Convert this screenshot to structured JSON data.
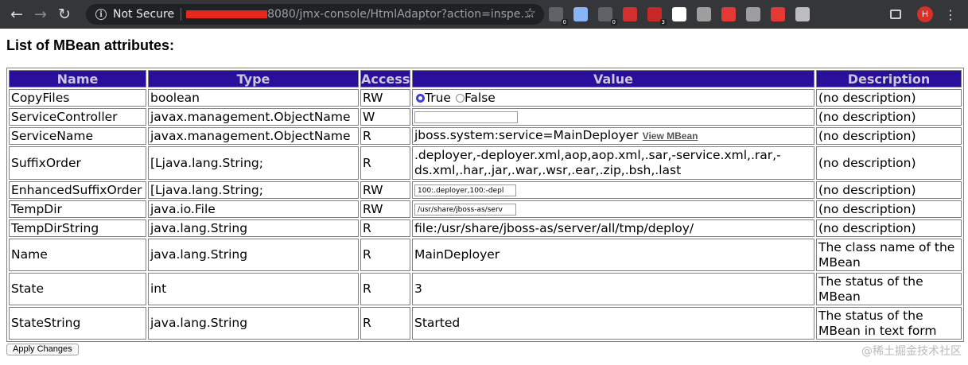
{
  "browser": {
    "security_label": "Not Secure",
    "url_visible": "8080/jmx-console/HtmlAdaptor?action=inspe...",
    "avatar_initial": "H",
    "extensions": [
      {
        "icon": "shield-extension-icon",
        "color": "#5f6368",
        "badge": "0"
      },
      {
        "icon": "drive-icon",
        "color": "#8ab4f8",
        "badge": ""
      },
      {
        "icon": "parking-icon",
        "color": "#5f6368",
        "badge": "0"
      },
      {
        "icon": "adblock-plus-icon",
        "color": "#d32f2f",
        "badge": ""
      },
      {
        "icon": "puzzle-extension-icon",
        "color": "#c62828",
        "badge": "3"
      },
      {
        "icon": "shield-check-icon",
        "color": "#ffffff",
        "badge": ""
      },
      {
        "icon": "mail-icon",
        "color": "#9e9e9e",
        "badge": ""
      },
      {
        "icon": "record-icon",
        "color": "#e53935",
        "badge": ""
      },
      {
        "icon": "grammarly-icon",
        "color": "#9e9e9e",
        "badge": ""
      },
      {
        "icon": "block-icon",
        "color": "#e53935",
        "badge": ""
      },
      {
        "icon": "grid-extension-icon",
        "color": "#bdbdbd",
        "badge": ""
      }
    ]
  },
  "page": {
    "heading": "List of MBean attributes:",
    "apply_button": "Apply Changes",
    "watermark": "@稀土掘金技术社区"
  },
  "table": {
    "headers": [
      "Name",
      "Type",
      "Access",
      "Value",
      "Description"
    ],
    "rows": [
      {
        "name": "CopyFiles",
        "type": "boolean",
        "access": "RW",
        "value_kind": "radio",
        "radio_true": "True",
        "radio_false": "False",
        "selected": "True",
        "description": "(no description)"
      },
      {
        "name": "ServiceController",
        "type": "javax.management.ObjectName",
        "access": "W",
        "value_kind": "object-input",
        "value": "",
        "description": "(no description)"
      },
      {
        "name": "ServiceName",
        "type": "javax.management.ObjectName",
        "access": "R",
        "value_kind": "text-link",
        "value": "jboss.system:service=MainDeployer",
        "link": "View MBean",
        "description": "(no description)"
      },
      {
        "name": "SuffixOrder",
        "type": "[Ljava.lang.String;",
        "access": "R",
        "value_kind": "text-wrap",
        "value": ".deployer,-deployer.xml,aop,aop.xml,.sar,-service.xml,.rar,-ds.xml,.har,.jar,.war,.wsr,.ear,.zip,.bsh,.last",
        "description": "(no description)"
      },
      {
        "name": "EnhancedSuffixOrder",
        "type": "[Ljava.lang.String;",
        "access": "RW",
        "value_kind": "input",
        "value": "100:.deployer,100:-depl",
        "description": "(no description)"
      },
      {
        "name": "TempDir",
        "type": "java.io.File",
        "access": "RW",
        "value_kind": "input",
        "value": "/usr/share/jboss-as/serv",
        "description": "(no description)"
      },
      {
        "name": "TempDirString",
        "type": "java.lang.String",
        "access": "R",
        "value_kind": "text",
        "value": "file:/usr/share/jboss-as/server/all/tmp/deploy/",
        "description": "(no description)"
      },
      {
        "name": "Name",
        "type": "java.lang.String",
        "access": "R",
        "value_kind": "text",
        "value": "MainDeployer",
        "description": "The class name of the MBean"
      },
      {
        "name": "State",
        "type": "int",
        "access": "R",
        "value_kind": "text",
        "value": "3",
        "description": "The status of the MBean"
      },
      {
        "name": "StateString",
        "type": "java.lang.String",
        "access": "R",
        "value_kind": "text",
        "value": "Started",
        "description": "The status of the MBean in text form"
      }
    ]
  }
}
